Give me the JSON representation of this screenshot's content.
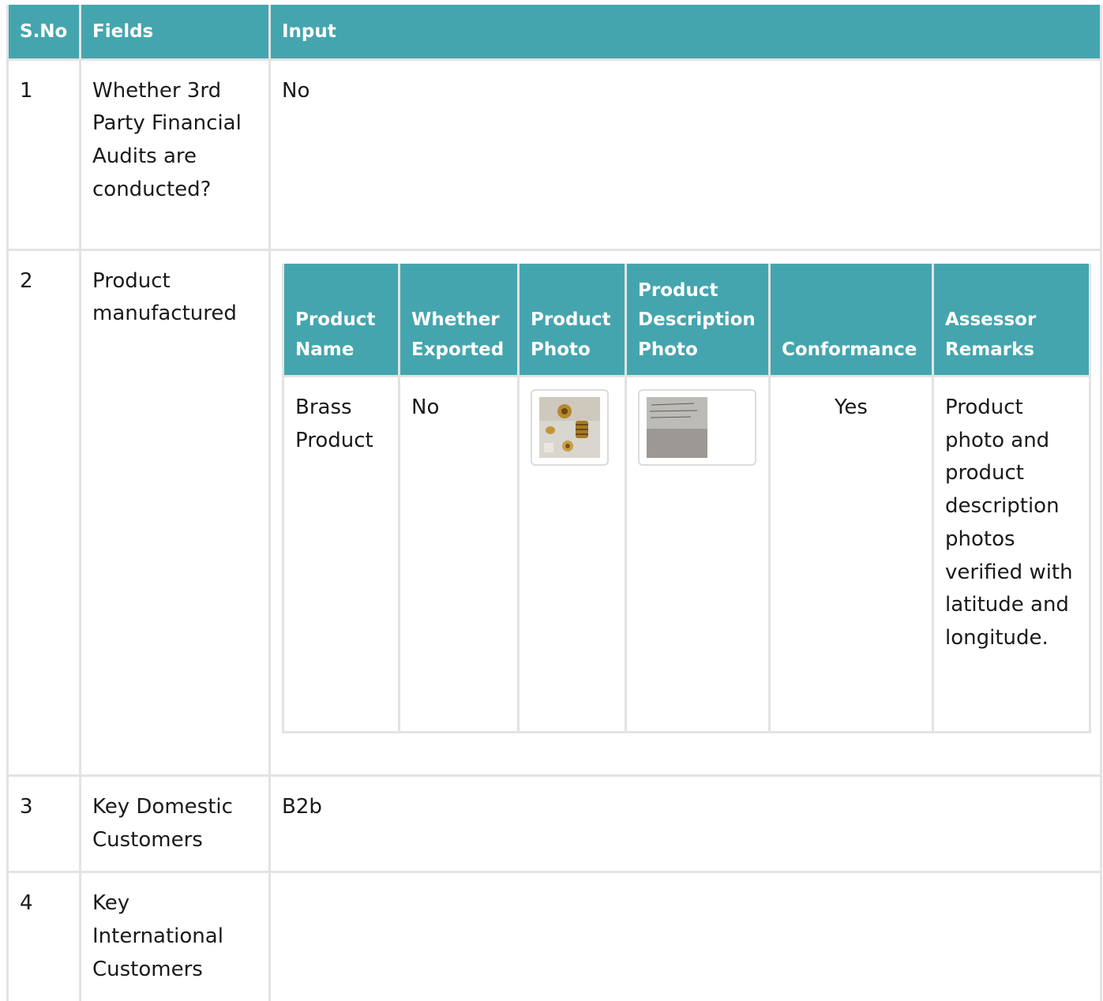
{
  "header": {
    "sno": "S.No",
    "fields": "Fields",
    "input": "Input"
  },
  "rows": [
    {
      "sno": "1",
      "field": "Whether 3rd Party Financial Audits are conducted?",
      "input": "No"
    },
    {
      "sno": "2",
      "field": "Product manufactured"
    },
    {
      "sno": "3",
      "field": "Key Domestic Customers",
      "input": "B2b"
    },
    {
      "sno": "4",
      "field": "Key International Customers",
      "input": ""
    }
  ],
  "products_table": {
    "headers": {
      "name": "Product Name",
      "exported": "Whether Exported",
      "photo": "Product Photo",
      "desc_photo": "Product Description Photo",
      "conformance": "Conformance",
      "remarks": "Assessor Remarks"
    },
    "rows": [
      {
        "name": "Brass Product",
        "exported": "No",
        "photo_icon": "brass-parts-photo",
        "desc_photo_icon": "handwritten-note-photo",
        "conformance": "Yes",
        "remarks": "Product photo and product description photos verified with latitude and longitude."
      }
    ]
  },
  "colors": {
    "header_bg": "#45a5ae",
    "header_text": "#ffffff",
    "border": "#e3e3e3"
  }
}
